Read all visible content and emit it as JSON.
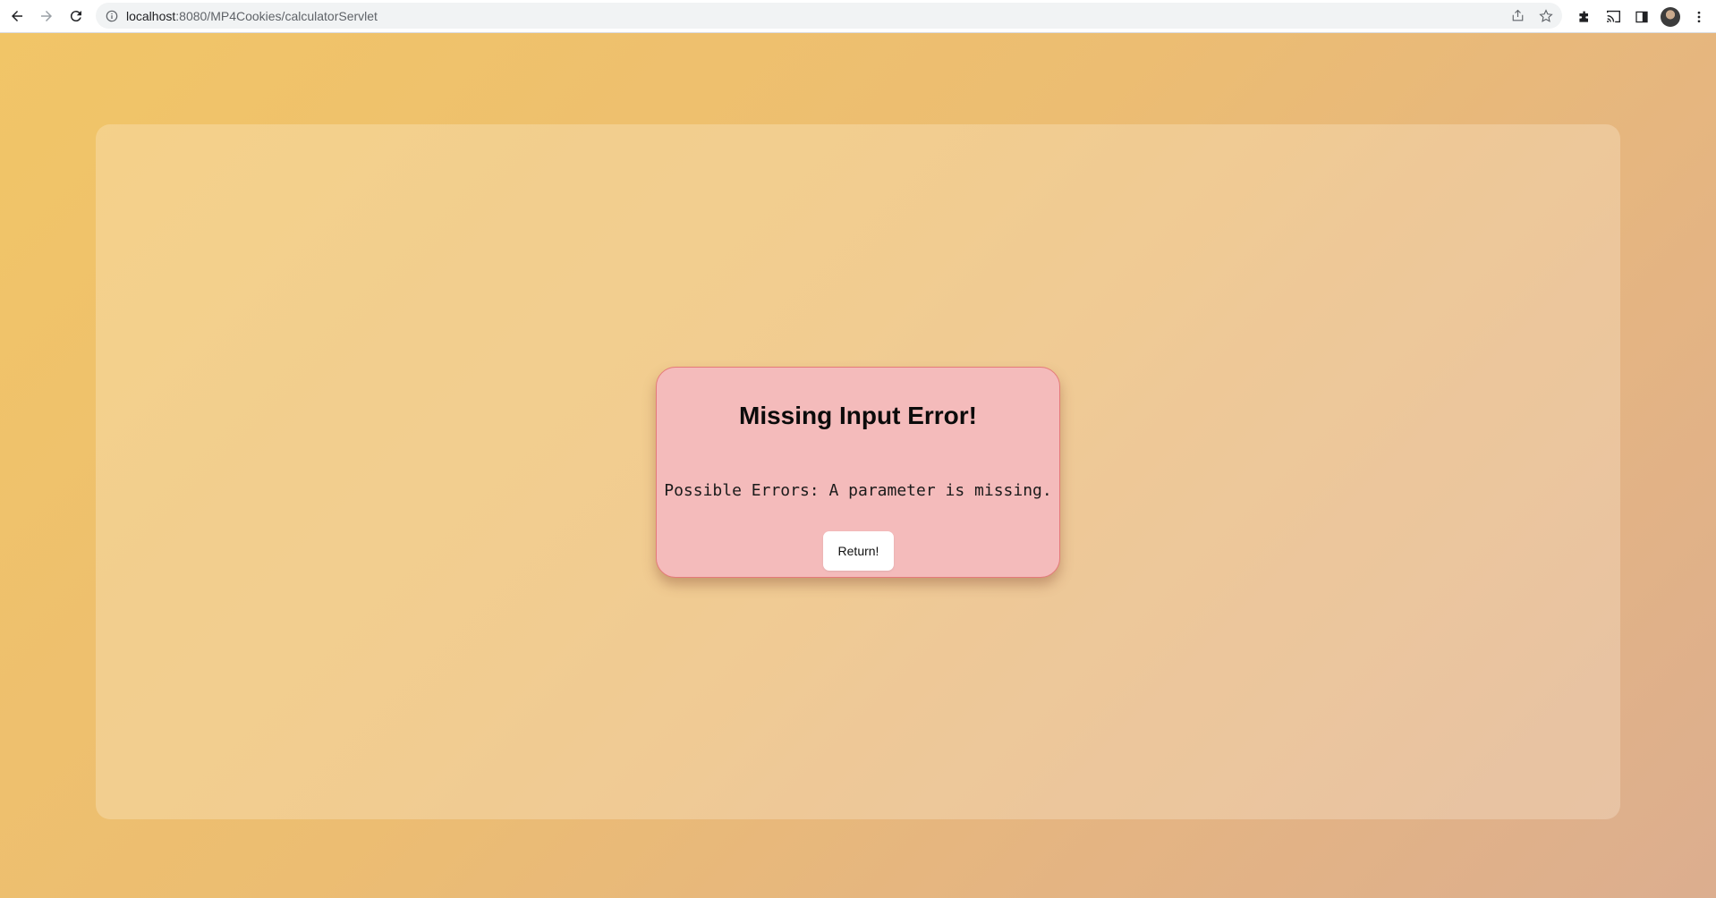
{
  "browser": {
    "url_host": "localhost",
    "url_path": ":8080/MP4Cookies/calculatorServlet",
    "icons": [
      "back-icon",
      "forward-icon",
      "reload-icon",
      "info-icon",
      "share-icon",
      "star-icon",
      "extensions-icon",
      "cast-icon",
      "side-panel-icon",
      "avatar",
      "more-menu-icon"
    ]
  },
  "error": {
    "title": "Missing Input Error!",
    "message": "Possible Errors: A parameter is missing.",
    "button_label": "Return!"
  },
  "colors": {
    "background_start": "#f1c567",
    "background_end": "#dcae8f",
    "card_background": "#f4bbbb",
    "card_border": "#e57a7a",
    "button_background": "#ffffff"
  }
}
